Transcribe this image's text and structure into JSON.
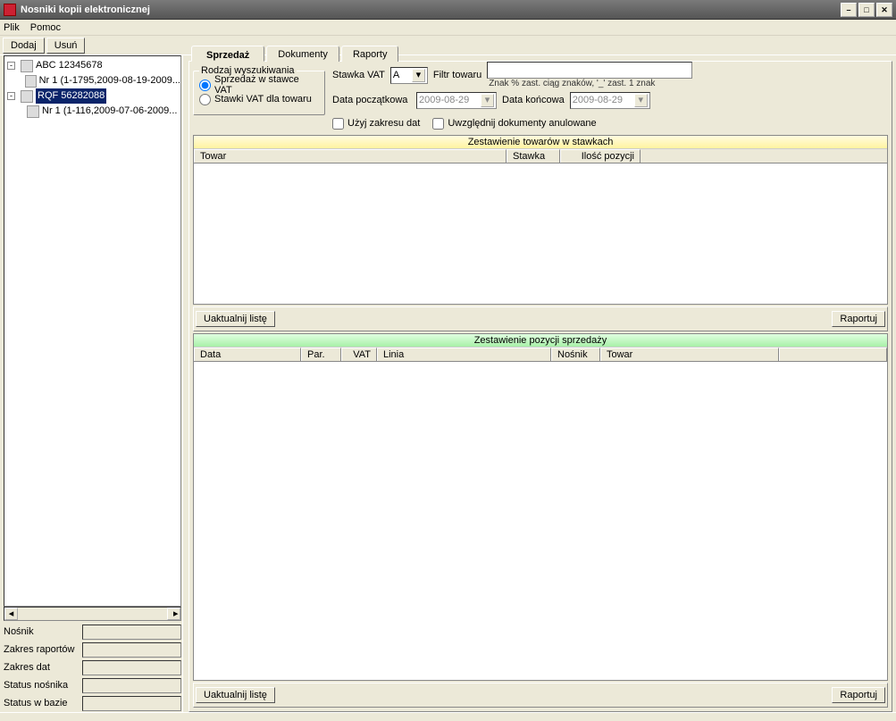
{
  "window": {
    "title": "Nosniki kopii elektronicznej"
  },
  "menu": {
    "file": "Plik",
    "help": "Pomoc"
  },
  "toolbar": {
    "add": "Dodaj",
    "remove": "Usuń"
  },
  "tree": {
    "root1": {
      "label": "ABC 12345678",
      "child": "Nr 1 (1-1795,2009-08-19-2009..."
    },
    "root2": {
      "label": "RQF 56282088",
      "child": "Nr 1 (1-116,2009-07-06-2009..."
    }
  },
  "props": {
    "nosnik": "Nośnik",
    "zakres_raportow": "Zakres raportów",
    "zakres_dat": "Zakres dat",
    "status_nosnika": "Status nośnika",
    "status_bazie": "Status w bazie"
  },
  "tabs": {
    "sprzedaz": "Sprzedaż",
    "dokumenty": "Dokumenty",
    "raporty": "Raporty"
  },
  "search": {
    "legend": "Rodzaj wyszukiwania",
    "opt1": "Sprzedaż w stawce VAT",
    "opt2": "Stawki VAT dla towaru",
    "stawka_label": "Stawka VAT",
    "stawka_val": "A",
    "filtr_label": "Filtr towaru",
    "filtr_hint": "Znak % zast. ciąg znaków, '_' zast. 1 znak",
    "data_pocz_label": "Data początkowa",
    "data_pocz_val": "2009-08-29",
    "data_konc_label": "Data końcowa",
    "data_konc_val": "2009-08-29",
    "chk1": "Użyj zakresu dat",
    "chk2": "Uwzględnij dokumenty anulowane"
  },
  "table1": {
    "banner": "Zestawienie towarów w stawkach",
    "cols": {
      "towar": "Towar",
      "stawka": "Stawka",
      "ilosc": "Ilość pozycji"
    }
  },
  "table2": {
    "banner": "Zestawienie pozycji sprzedaży",
    "cols": {
      "data": "Data",
      "par": "Par.",
      "vat": "VAT",
      "linia": "Linia",
      "nosnik": "Nośnik",
      "towar": "Towar"
    }
  },
  "buttons": {
    "update": "Uaktualnij listę",
    "report": "Raportuj"
  }
}
